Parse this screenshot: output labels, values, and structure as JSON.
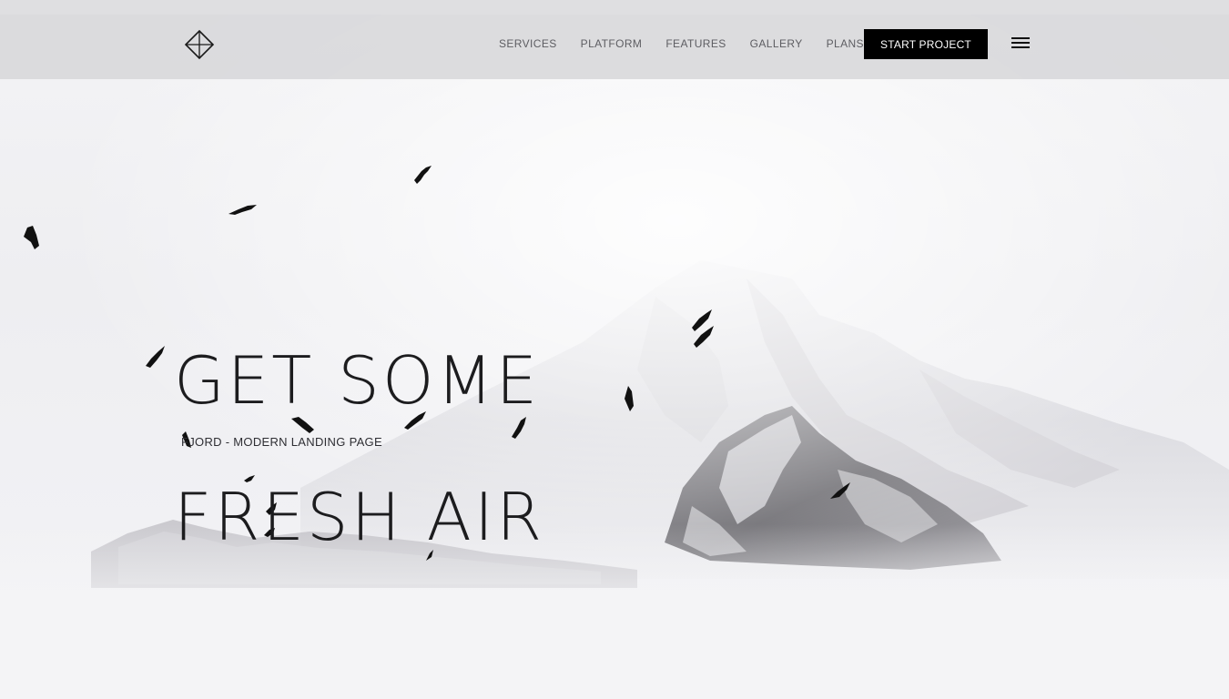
{
  "nav": {
    "logo_icon": "diamond-logo-icon",
    "links": [
      "SERVICES",
      "PLATFORM",
      "FEATURES",
      "GALLERY",
      "PLANS"
    ],
    "cta_label": "START PROJECT",
    "menu_icon": "hamburger-menu-icon"
  },
  "hero": {
    "headline_line1": "GET SOME",
    "headline_line2": "FRESH AIR",
    "subtitle": "FJORD - MODERN LANDING PAGE",
    "background_image": "snowy-mountain-with-birds"
  },
  "colors": {
    "navbar_bg": "#d5d5d8",
    "cta_bg": "#000000",
    "text": "#1c1c1e"
  }
}
